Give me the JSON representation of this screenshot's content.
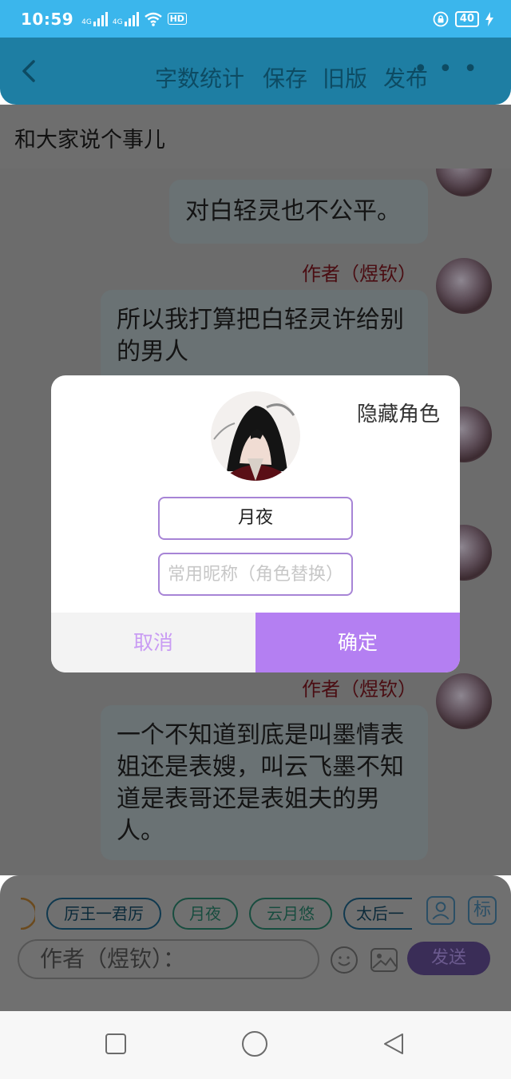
{
  "status_bar": {
    "time": "10:59",
    "signal1_label": "4G",
    "signal2_label": "4G",
    "hd_label": "HD",
    "battery": "40"
  },
  "header": {
    "btn_word_count": "字数统计",
    "btn_save": "保存",
    "btn_old_version": "旧版",
    "btn_publish": "发布",
    "more": "• • •"
  },
  "chapter_title": "和大家说个事儿",
  "messages": [
    {
      "text": "对白轻灵也不公平。"
    },
    {
      "author": "作者（煜钦）",
      "text": "所以我打算把白轻灵许给别的男人"
    },
    {
      "author": "作者（煜钦）",
      "text": "一个不知道到底是叫墨情表姐还是表嫂，叫云飞墨不知道是表哥还是表姐夫的男人。"
    }
  ],
  "dialog": {
    "hide_role": "隐藏角色",
    "name_value": "月夜",
    "nickname_placeholder": "常用昵称（角色替换）",
    "cancel": "取消",
    "confirm": "确定"
  },
  "bottom_panel": {
    "chips": [
      "厉王一君厉",
      "月夜",
      "云月悠",
      "太后一"
    ],
    "user_icon": "user-icon",
    "tag_label": "标",
    "input_placeholder": "作者（煜钦）：",
    "send": "发送"
  },
  "colors": {
    "status_bar": "#3bb6ec",
    "accent_purple": "#b47ff2",
    "author_red": "#8a1b22"
  }
}
